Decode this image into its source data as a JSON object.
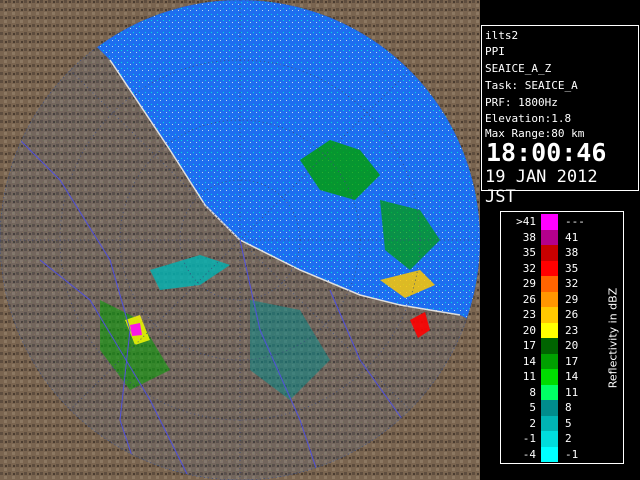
{
  "info": {
    "station": "ilts2",
    "product": "PPI",
    "task_name": "SEAICE_A_Z",
    "task": "Task: SEAICE_A",
    "prf": "PRF: 1800Hz",
    "elevation": "Elevation:1.8",
    "max_range": "Max Range:80 km",
    "time": "18:00:46",
    "date": "19 JAN 2012 JST"
  },
  "legend": {
    "title": "Reflectivity in dBZ",
    "bins": [
      {
        "low": ">41",
        "high": "---",
        "color": "#ff00ff"
      },
      {
        "low": "38",
        "high": "41",
        "color": "#b4008c"
      },
      {
        "low": "35",
        "high": "38",
        "color": "#c80000"
      },
      {
        "low": "32",
        "high": "35",
        "color": "#ff0000"
      },
      {
        "low": "29",
        "high": "32",
        "color": "#ff6400"
      },
      {
        "low": "26",
        "high": "29",
        "color": "#ff9600"
      },
      {
        "low": "23",
        "high": "26",
        "color": "#ffc800"
      },
      {
        "low": "20",
        "high": "23",
        "color": "#ffff00"
      },
      {
        "low": "17",
        "high": "20",
        "color": "#006400"
      },
      {
        "low": "14",
        "high": "17",
        "color": "#00a000"
      },
      {
        "low": "11",
        "high": "14",
        "color": "#00dc00"
      },
      {
        "low": "8",
        "high": "11",
        "color": "#00ff64"
      },
      {
        "low": "5",
        "high": "8",
        "color": "#008c8c"
      },
      {
        "low": "2",
        "high": "5",
        "color": "#00b4b4"
      },
      {
        "low": "-1",
        "high": "2",
        "color": "#00dcdc"
      },
      {
        "low": "-4",
        "high": "-1",
        "color": "#00ffff"
      }
    ]
  },
  "map": {
    "sea_color": "#1e6ef0",
    "land_color": "#786452",
    "range_ring_color": "#324678",
    "boundary_color": "#5050dc"
  }
}
